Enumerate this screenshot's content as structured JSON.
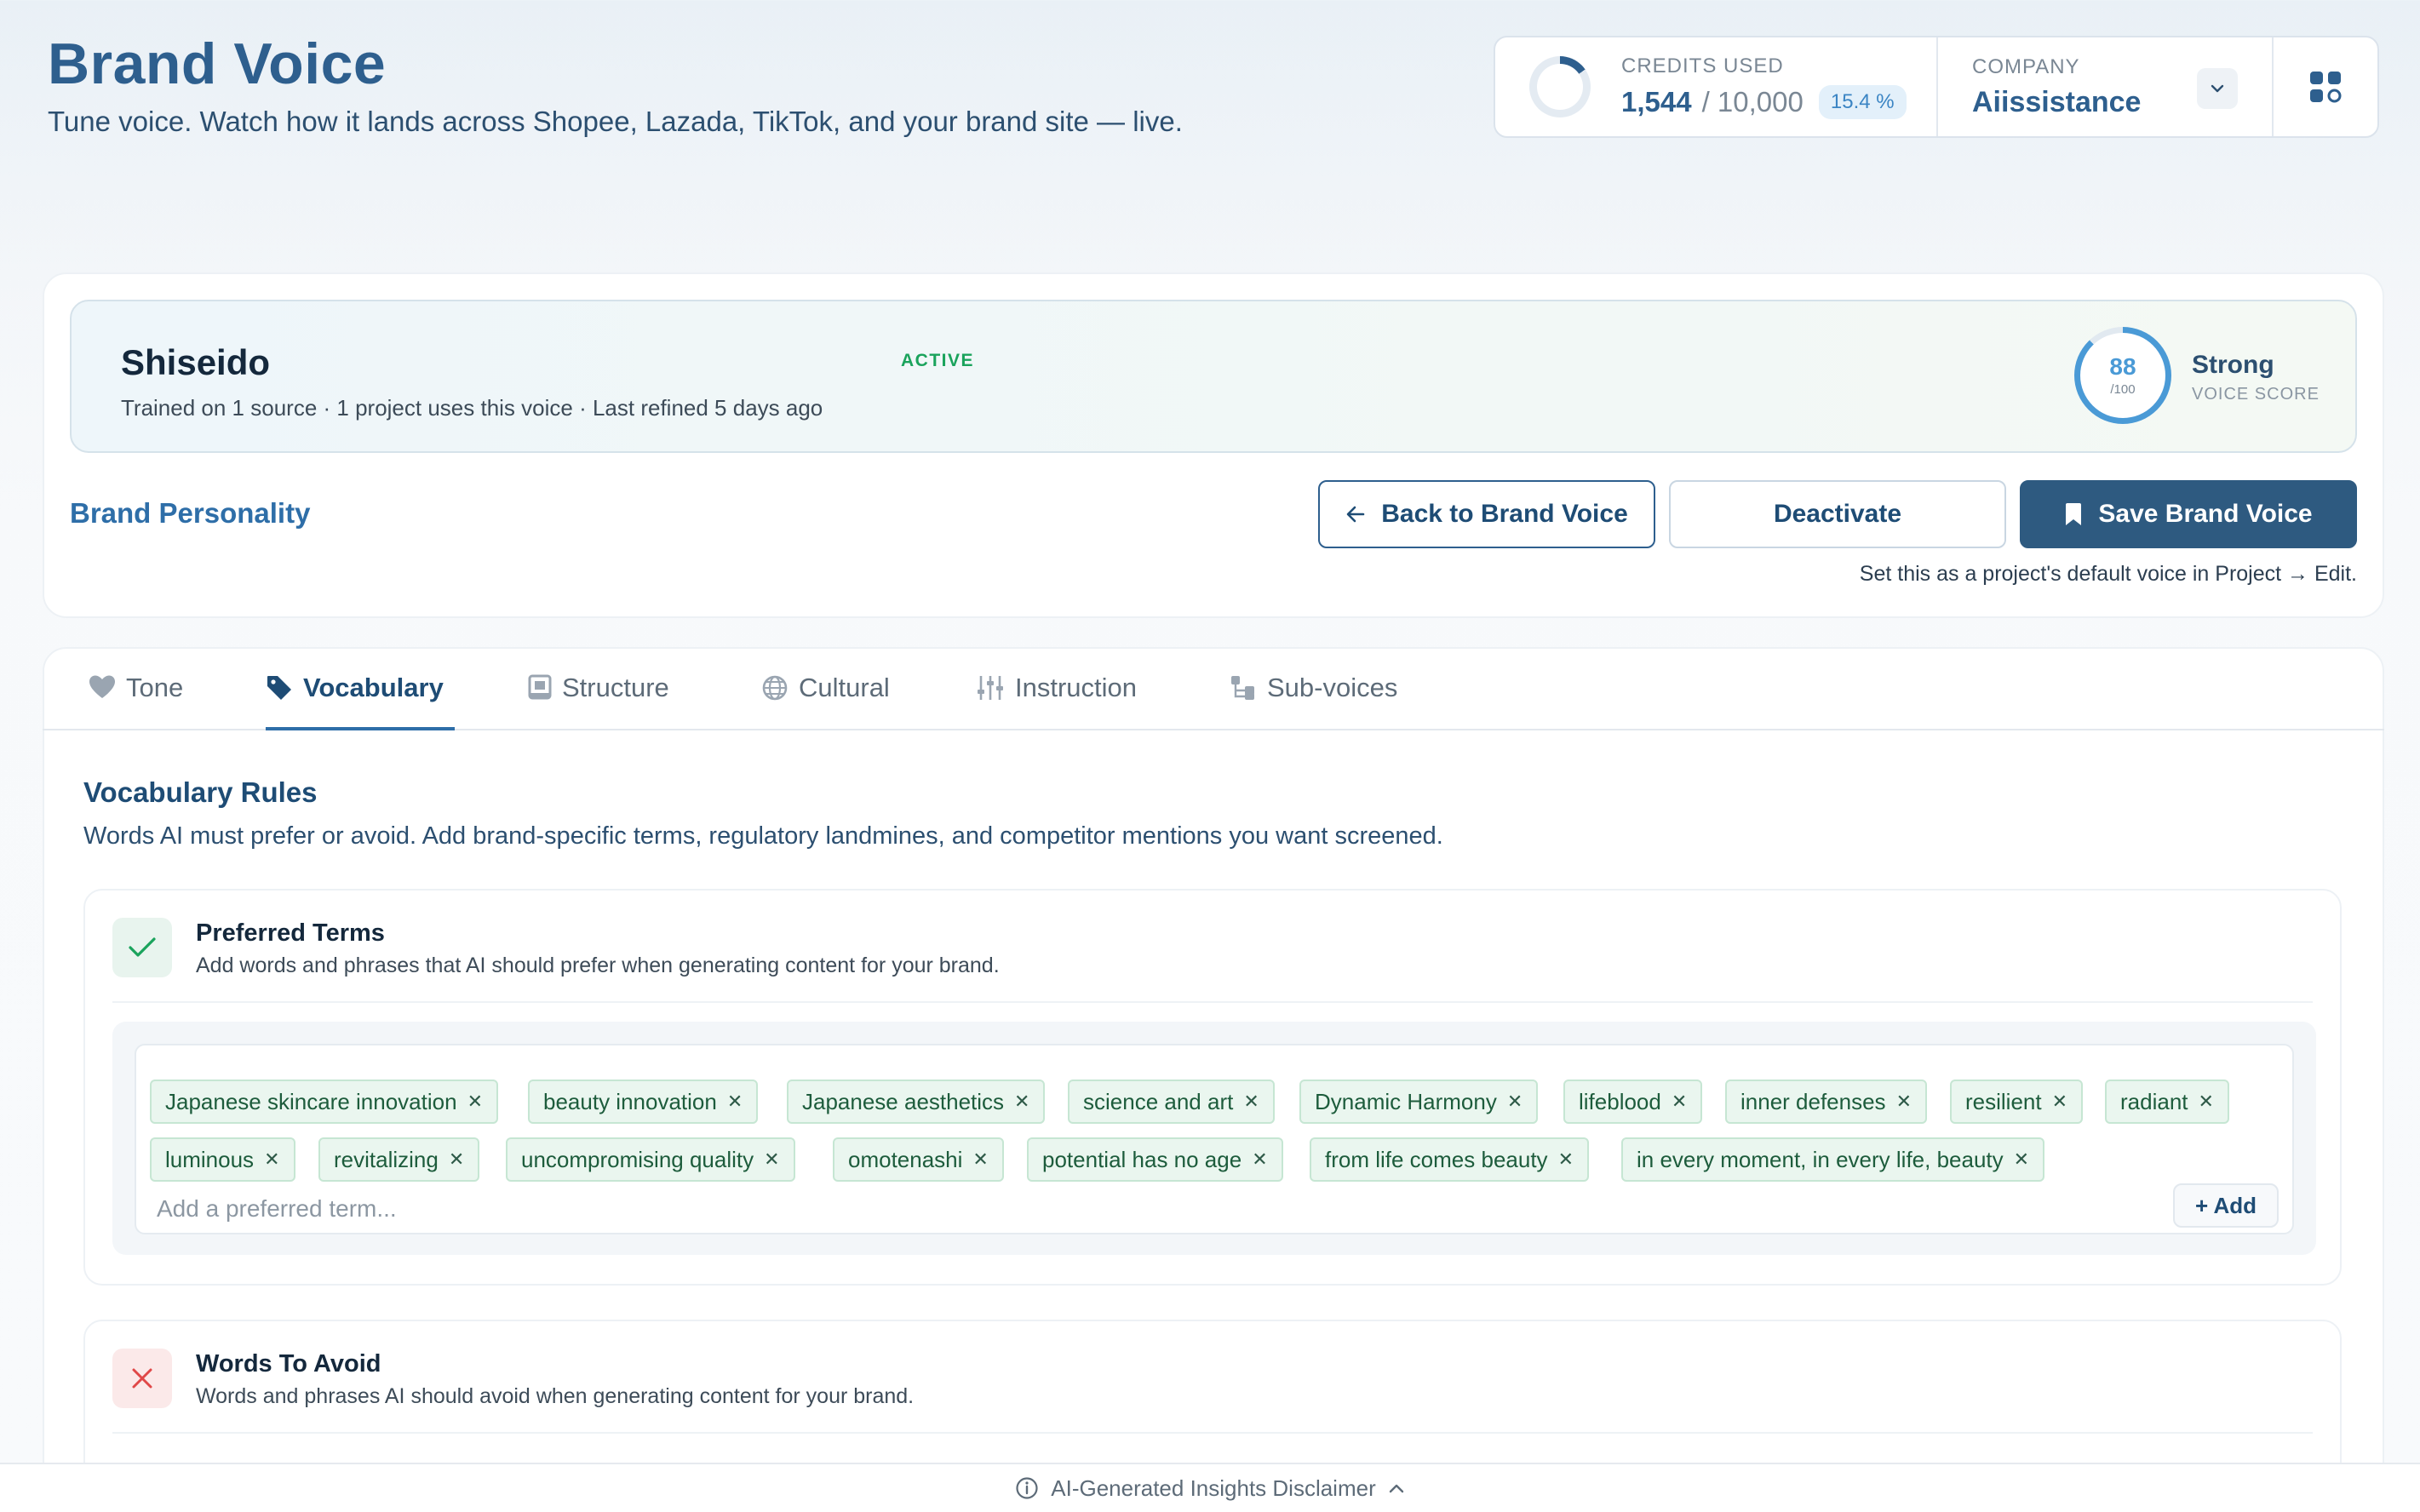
{
  "header": {
    "title": "Brand Voice",
    "subtitle": "Tune voice. Watch how it lands across Shopee, Lazada, TikTok, and your brand site — live."
  },
  "credits": {
    "label": "CREDITS USED",
    "used": "1,544",
    "total": "/ 10,000",
    "percent": "15.4 %",
    "fraction_used": 0.154
  },
  "company": {
    "label": "COMPANY",
    "name": "Aiissistance"
  },
  "voice": {
    "name": "Shiseido",
    "status": "ACTIVE",
    "meta": "Trained on 1 source · 1 project uses this voice · Last refined 5 days ago",
    "score": "88",
    "score_max": "/100",
    "score_word": "Strong",
    "score_label": "VOICE SCORE"
  },
  "personality": {
    "title": "Brand Personality",
    "back_label": "Back to Brand Voice",
    "deactivate_label": "Deactivate",
    "save_label": "Save Brand Voice",
    "hint": "Set this as a project's default voice in Project → Edit."
  },
  "tabs": [
    {
      "label": "Tone",
      "icon": "heart-icon"
    },
    {
      "label": "Vocabulary",
      "icon": "tag-icon"
    },
    {
      "label": "Structure",
      "icon": "structure-icon"
    },
    {
      "label": "Cultural",
      "icon": "globe-icon"
    },
    {
      "label": "Instruction",
      "icon": "sliders-icon"
    },
    {
      "label": "Sub-voices",
      "icon": "subvoices-icon"
    }
  ],
  "vocab": {
    "title": "Vocabulary Rules",
    "subtitle": "Words AI must prefer or avoid. Add brand-specific terms, regulatory landmines, and competitor mentions you want screened."
  },
  "preferred": {
    "title": "Preferred Terms",
    "desc": "Add words and phrases that AI should prefer when generating content for your brand.",
    "terms": [
      "Japanese skincare innovation",
      "beauty innovation",
      "Japanese aesthetics",
      "science and art",
      "Dynamic Harmony",
      "lifeblood",
      "inner defenses",
      "resilient",
      "radiant",
      "luminous",
      "revitalizing",
      "uncompromising quality",
      "omotenashi",
      "potential has no age",
      "from life comes beauty",
      "in every moment, in every life, beauty"
    ],
    "placeholder": "Add a preferred term...",
    "add_label": "+ Add"
  },
  "avoid": {
    "title": "Words To Avoid",
    "desc": "Words and phrases AI should avoid when generating content for your brand."
  },
  "footer": {
    "disclaimer": "AI-Generated Insights Disclaimer"
  },
  "colors": {
    "brand": "#2e5f8e",
    "accent": "#2e6ea8",
    "chip_bg": "#eaf6ef",
    "active": "#1aa35c"
  }
}
